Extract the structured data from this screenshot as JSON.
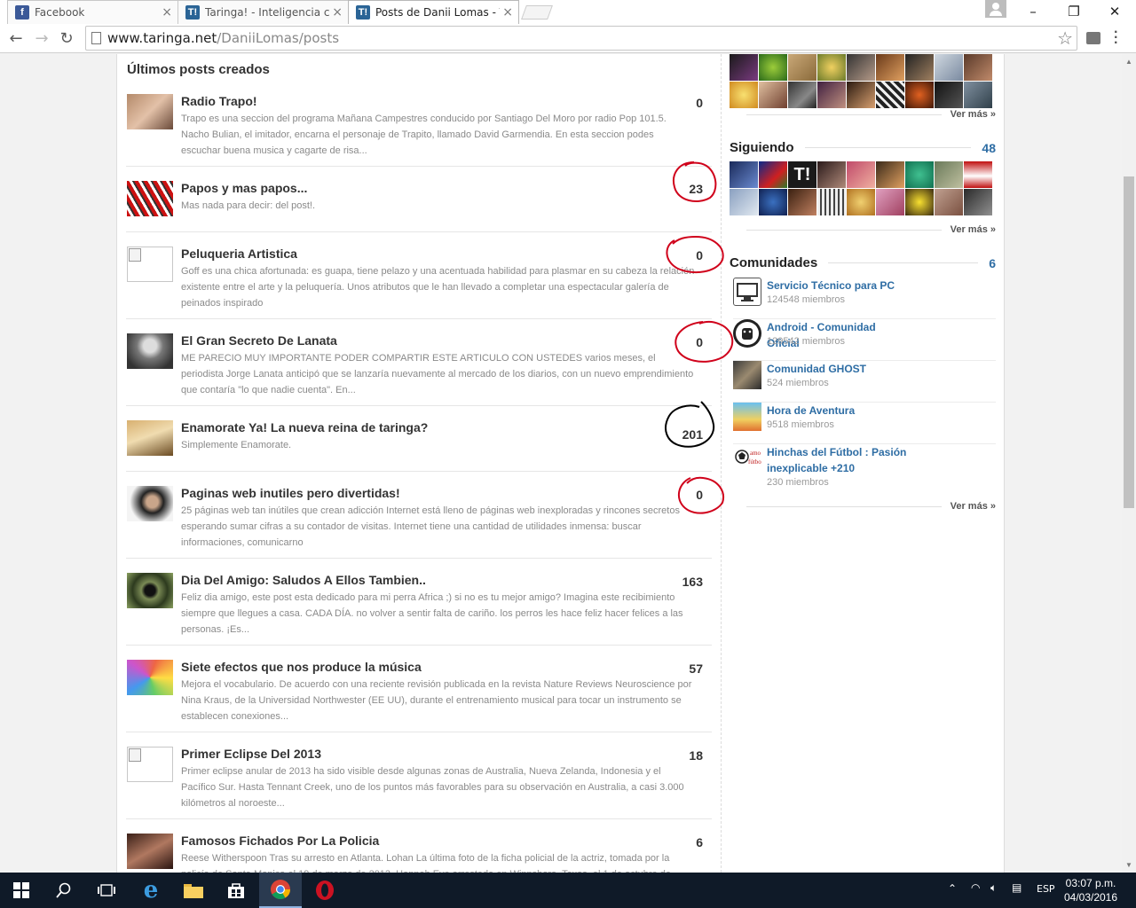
{
  "browser": {
    "tabs": [
      {
        "title": "Facebook",
        "icon": "facebook-favicon",
        "active": false
      },
      {
        "title": "Taringa! - Inteligencia cole",
        "icon": "taringa-favicon",
        "active": false
      },
      {
        "title": "Posts de Danii Lomas - Tar",
        "icon": "taringa-favicon",
        "active": true
      }
    ],
    "url_host": "www.taringa.net",
    "url_path": "/DaniiLomas/posts",
    "close_glyph": "×"
  },
  "main": {
    "section_title": "Últimos posts creados",
    "posts": [
      {
        "title": "Radio Trapo!",
        "count": "0",
        "excerpt": "Trapo es una seccion del programa Mañana Campestres conducido por Santiago Del Moro por radio Pop 101.5. Nacho Bulian, el imitador, encarna el personaje de Trapito, llamado David Garmendia. En esta seccion podes escuchar buena musica y cagarte de risa..."
      },
      {
        "title": "Papos y mas papos...",
        "count": "23",
        "excerpt": "Mas nada para decir: del post!."
      },
      {
        "title": "Peluqueria Artistica",
        "count": "0",
        "excerpt": "Goff es una chica afortunada: es guapa, tiene pelazo y una acentuada habilidad para plasmar en su cabeza la relación existente entre el arte y la peluquería. Unos atributos que le han llevado a completar una espectacular galería de peinados inspirado"
      },
      {
        "title": "El Gran Secreto De Lanata",
        "count": "0",
        "excerpt": "ME PARECIO MUY IMPORTANTE PODER COMPARTIR ESTE ARTICULO CON USTEDES varios meses, el periodista Jorge Lanata anticipó que se lanzaría nuevamente al mercado de los diarios, con un nuevo emprendimiento que contaría \"lo que nadie cuenta\". En..."
      },
      {
        "title": "Enamorate Ya! La nueva reina de taringa?",
        "count": "201",
        "excerpt": "Simplemente Enamorate."
      },
      {
        "title": "Paginas web inutiles pero divertidas!",
        "count": "0",
        "excerpt": "25 páginas web tan inútiles que crean adicción Internet está lleno de páginas web inexploradas y rincones secretos esperando sumar cifras a su contador de visitas. Internet tiene una cantidad de utilidades inmensa: buscar informaciones, comunicarno"
      },
      {
        "title": "Dia Del Amigo: Saludos A Ellos Tambien..",
        "count": "163",
        "excerpt": "Feliz dia amigo, este post esta dedicado para mi perra Africa ;) si no es tu mejor amigo? Imagina este recibimiento siempre que llegues a casa. CADA DÍA. no volver a sentir falta de cariño. los perros les hace feliz hacer felices a las personas. ¡Es..."
      },
      {
        "title": "Siete efectos que nos produce la música",
        "count": "57",
        "excerpt": "Mejora el vocabulario. De acuerdo con una reciente revisión publicada en la revista Nature Reviews Neuroscience por Nina Kraus, de la Universidad Northwester (EE UU), durante el entrenamiento musical para tocar un instrumento se establecen conexiones..."
      },
      {
        "title": "Primer Eclipse Del 2013",
        "count": "18",
        "excerpt": "Primer eclipse anular de 2013 ha sido visible desde algunas zonas de Australia, Nueva Zelanda, Indonesia y el Pacífico Sur. Hasta Tennant Creek, uno de los puntos más favorables para su observación en Australia, a casi 3.000 kilómetros al noroeste..."
      },
      {
        "title": "Famosos Fichados Por La Policia",
        "count": "6",
        "excerpt": "Reese Witherspoon Tras su arresto en Atlanta. Lohan La última foto de la ficha policial de la actriz, tomada por la policía de Santa Monica el 19 de marzo de 2013. Hannah Eve arrestada en Winnsboro, Texas, el 1 de octubre de"
      }
    ]
  },
  "sidebar": {
    "ver_mas": "Ver más »",
    "siguiendo": {
      "label": "Siguiendo",
      "count": "48"
    },
    "comunidades": {
      "label": "Comunidades",
      "count": "6",
      "items": [
        {
          "name": "Servicio Técnico para PC",
          "members": "124548 miembros"
        },
        {
          "name": "Android - Comunidad Oficial",
          "members": "129542 miembros"
        },
        {
          "name": "Comunidad GHOST",
          "members": "524 miembros"
        },
        {
          "name": "Hora de Aventura",
          "members": "9518 miembros"
        },
        {
          "name": "Hinchas del Fútbol : Pasión inexplicable +210",
          "members": "230 miembros"
        }
      ]
    }
  },
  "taskbar": {
    "language": "ESP",
    "time": "03:07 p.m.",
    "date": "04/03/2016"
  },
  "colors": {
    "link_blue": "#2e6da4",
    "annotation_red": "#d0021b",
    "annotation_black": "#000000"
  }
}
